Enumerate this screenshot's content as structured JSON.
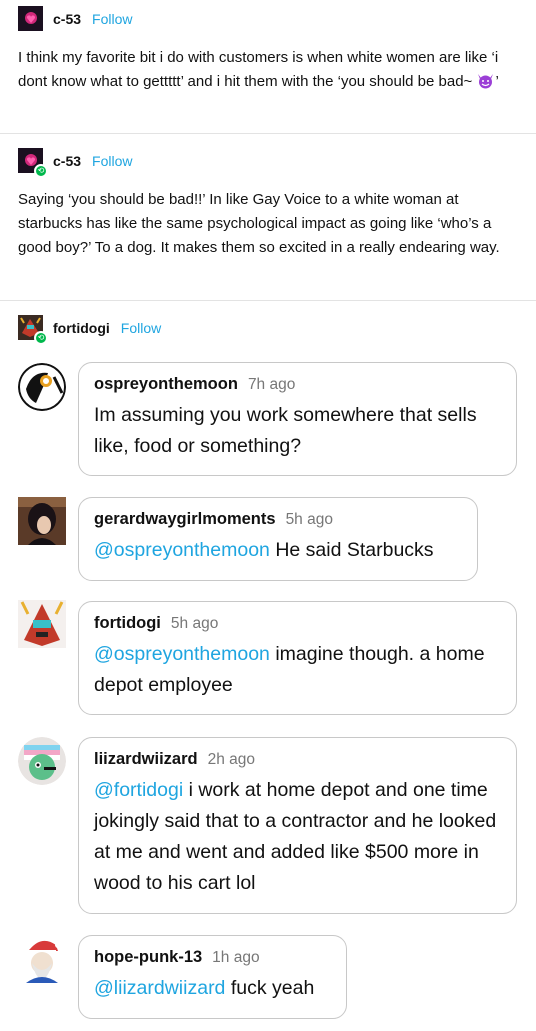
{
  "posts": [
    {
      "username": "c-53",
      "follow_label": "Follow",
      "body": "I think my favorite bit i do with customers is when white women are like ‘i dont know what to gettttt’ and i hit them with the ‘you should be bad~ ",
      "body_end": "’",
      "emoji": "smiling-devil-emoji"
    },
    {
      "username": "c-53",
      "follow_label": "Follow",
      "body": "Saying ‘you should be bad!!’ In like Gay Voice to a white woman at starbucks has like the same psychological impact as going like ‘who’s a good boy?’ To a dog. It makes them so excited in a really endearing way."
    },
    {
      "username": "fortidogi",
      "follow_label": "Follow"
    }
  ],
  "comments": [
    {
      "username": "ospreyonthemoon",
      "time": "7h ago",
      "mention": "",
      "text": "Im assuming you work somewhere that sells like, food or something?"
    },
    {
      "username": "gerardwaygirlmoments",
      "time": "5h ago",
      "mention": "@ospreyonthemoon",
      "text": " He said Starbucks"
    },
    {
      "username": "fortidogi",
      "time": "5h ago",
      "mention": "@ospreyonthemoon",
      "text": " imagine though. a home depot employee"
    },
    {
      "username": "liizardwiizard",
      "time": "2h ago",
      "mention": "@fortidogi",
      "text": " i work at home depot and one time jokingly said that to a contractor and he looked at me and went and added like $500 more in wood to his cart lol"
    },
    {
      "username": "hope-punk-13",
      "time": "1h ago",
      "mention": "@liizardwiizard",
      "text": " fuck yeah"
    }
  ],
  "colors": {
    "accent": "#1fa5e0",
    "reblog_badge": "#00b84c",
    "devil_emoji": "#9b3fd6"
  }
}
